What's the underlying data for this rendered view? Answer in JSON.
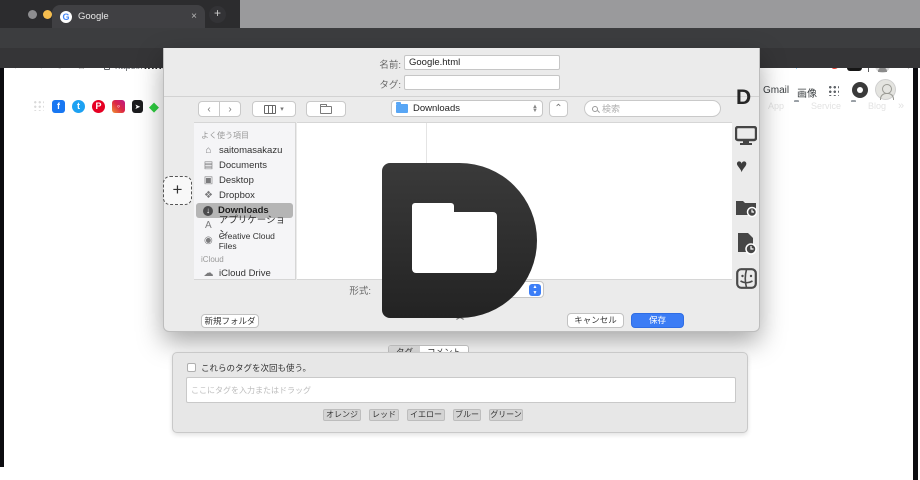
{
  "chrome": {
    "tab_title": "Google",
    "close_tab": "×",
    "new_tab": "+",
    "url_scheme": "https://",
    "url_host": "www.google.com",
    "favicon_letter": "G",
    "ab_badge": "AB",
    "bookmarks_right": {
      "app": "App",
      "service": "Service",
      "blog": "Blog",
      "overflow": "»"
    }
  },
  "page_header": {
    "gmail": "Gmail",
    "images": "画像"
  },
  "dialog": {
    "name_label": "名前:",
    "name_value": "Google.html",
    "tag_label": "タグ:",
    "tag_value": "",
    "location_value": "Downloads",
    "search_placeholder": "検索",
    "sidebar_favorites_header": "よく使う項目",
    "sidebar_items": [
      {
        "label": "saitomasakazu"
      },
      {
        "label": "Documents"
      },
      {
        "label": "Desktop"
      },
      {
        "label": "Dropbox"
      },
      {
        "label": "Downloads",
        "selected": true
      },
      {
        "label": "アプリケーション"
      },
      {
        "label": "Creative Cloud Files"
      }
    ],
    "sidebar_icloud_header": "iCloud",
    "sidebar_icloud_items": [
      {
        "label": "iCloud Drive"
      }
    ],
    "format_label": "形式:",
    "new_folder_button": "新規フォルダ",
    "cancel_button": "キャンセル",
    "save_button": "保存"
  },
  "tags_panel": {
    "tab_tags": "タグ",
    "tab_comment": "コメント",
    "checkbox_label": "これらのタグを次回も使う。",
    "input_placeholder": "ここにタグを入力またはドラッグ",
    "color_buttons": [
      {
        "label": "オレンジ"
      },
      {
        "label": "レッド"
      },
      {
        "label": "イエロー"
      },
      {
        "label": "ブルー"
      },
      {
        "label": "グリーン"
      }
    ]
  },
  "colors": {
    "accent_blue": "#3c7ef7",
    "save_button_blue": "#3b7cf5",
    "selection_gray": "#b5b5b5",
    "chrome_dark": "#3c3d3f"
  }
}
